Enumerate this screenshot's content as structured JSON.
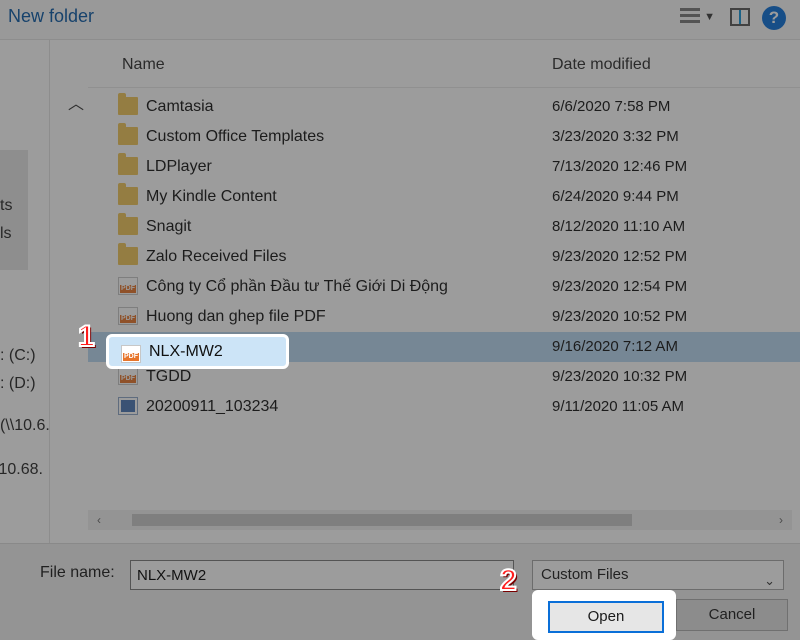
{
  "toolbar": {
    "new_folder": "New folder",
    "view_mode": "Details",
    "help": "?"
  },
  "sidebar": {
    "items": [
      "ts",
      "ls",
      ": (C:)",
      ": (D:)",
      "(\\\\10.6.",
      "\\10.68."
    ]
  },
  "columns": {
    "name": "Name",
    "modified": "Date modified"
  },
  "files": [
    {
      "type": "folder",
      "name": "Camtasia",
      "date": "6/6/2020 7:58 PM"
    },
    {
      "type": "folder",
      "name": "Custom Office Templates",
      "date": "3/23/2020 3:32 PM"
    },
    {
      "type": "folder",
      "name": "LDPlayer",
      "date": "7/13/2020 12:46 PM"
    },
    {
      "type": "folder",
      "name": "My Kindle Content",
      "date": "6/24/2020 9:44 PM"
    },
    {
      "type": "folder",
      "name": "Snagit",
      "date": "8/12/2020 11:10 AM"
    },
    {
      "type": "folder",
      "name": "Zalo Received Files",
      "date": "9/23/2020 12:52 PM"
    },
    {
      "type": "pdf",
      "name": "Công ty Cổ phần Đầu tư Thế Giới Di Động",
      "date": "9/23/2020 12:54 PM"
    },
    {
      "type": "pdf",
      "name": "Huong dan ghep file PDF",
      "date": "9/23/2020 10:52 PM"
    },
    {
      "type": "pdf",
      "name": "NLX-MW2",
      "date": "9/16/2020 7:12 AM",
      "selected": true
    },
    {
      "type": "pdf",
      "name": "TGDD",
      "date": "9/23/2020 10:32 PM"
    },
    {
      "type": "img",
      "name": "20200911_103234",
      "date": "9/11/2020 11:05 AM"
    }
  ],
  "footer": {
    "filename_label": "File name:",
    "filename_value": "NLX-MW2",
    "filter_selected": "Custom Files",
    "open": "Open",
    "cancel": "Cancel"
  },
  "annotations": {
    "one": "1",
    "two": "2"
  }
}
